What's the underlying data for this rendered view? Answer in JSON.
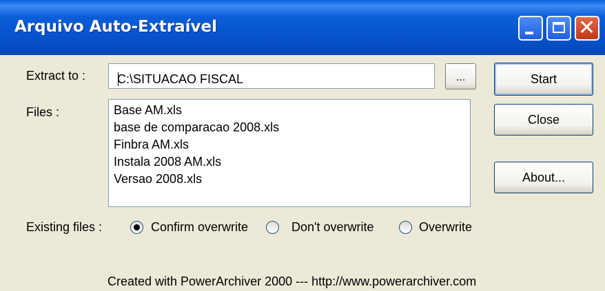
{
  "window": {
    "title": "Arquivo Auto-Extraível"
  },
  "extract": {
    "label": "Extract to :",
    "value": "C:\\SITUACAO FISCAL",
    "browse_label": "..."
  },
  "files": {
    "label": "Files :",
    "items": [
      "Base AM.xls",
      "base de comparacao 2008.xls",
      "Finbra AM.xls",
      "Instala 2008 AM.xls",
      "Versao 2008.xls"
    ]
  },
  "buttons": {
    "start": "Start",
    "close": "Close",
    "about": "About..."
  },
  "existing": {
    "label": "Existing files :",
    "options": [
      "Confirm overwrite",
      "Don't overwrite",
      "Overwrite"
    ],
    "selected": "Confirm overwrite"
  },
  "footer": "Created with PowerArchiver 2000 --- http://www.powerarchiver.com"
}
